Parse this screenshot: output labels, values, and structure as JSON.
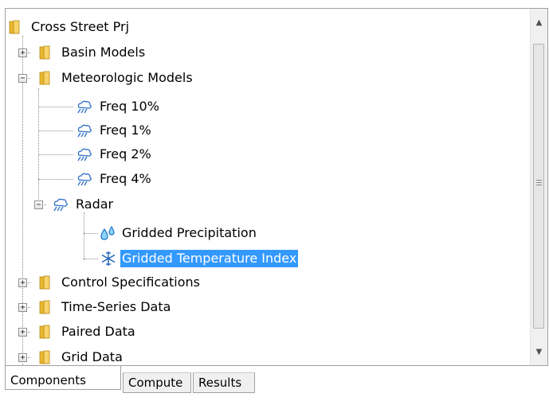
{
  "tree": {
    "root": "Cross Street Prj",
    "basin_models": "Basin Models",
    "meteorologic_models": "Meteorologic Models",
    "freq_10": "Freq 10%",
    "freq_1": "Freq 1%",
    "freq_2": "Freq 2%",
    "freq_4": "Freq 4%",
    "radar": "Radar",
    "gridded_precipitation": "Gridded Precipitation",
    "gridded_temperature_index": "Gridded Temperature Index",
    "control_specifications": "Control Specifications",
    "time_series_data": "Time-Series Data",
    "paired_data": "Paired Data",
    "grid_data": "Grid Data"
  },
  "tabs": {
    "components": "Components",
    "compute": "Compute",
    "results": "Results"
  },
  "colors": {
    "selection": "#3399ff",
    "folder": "#e9b72f",
    "weather": "#2d6fc8"
  }
}
